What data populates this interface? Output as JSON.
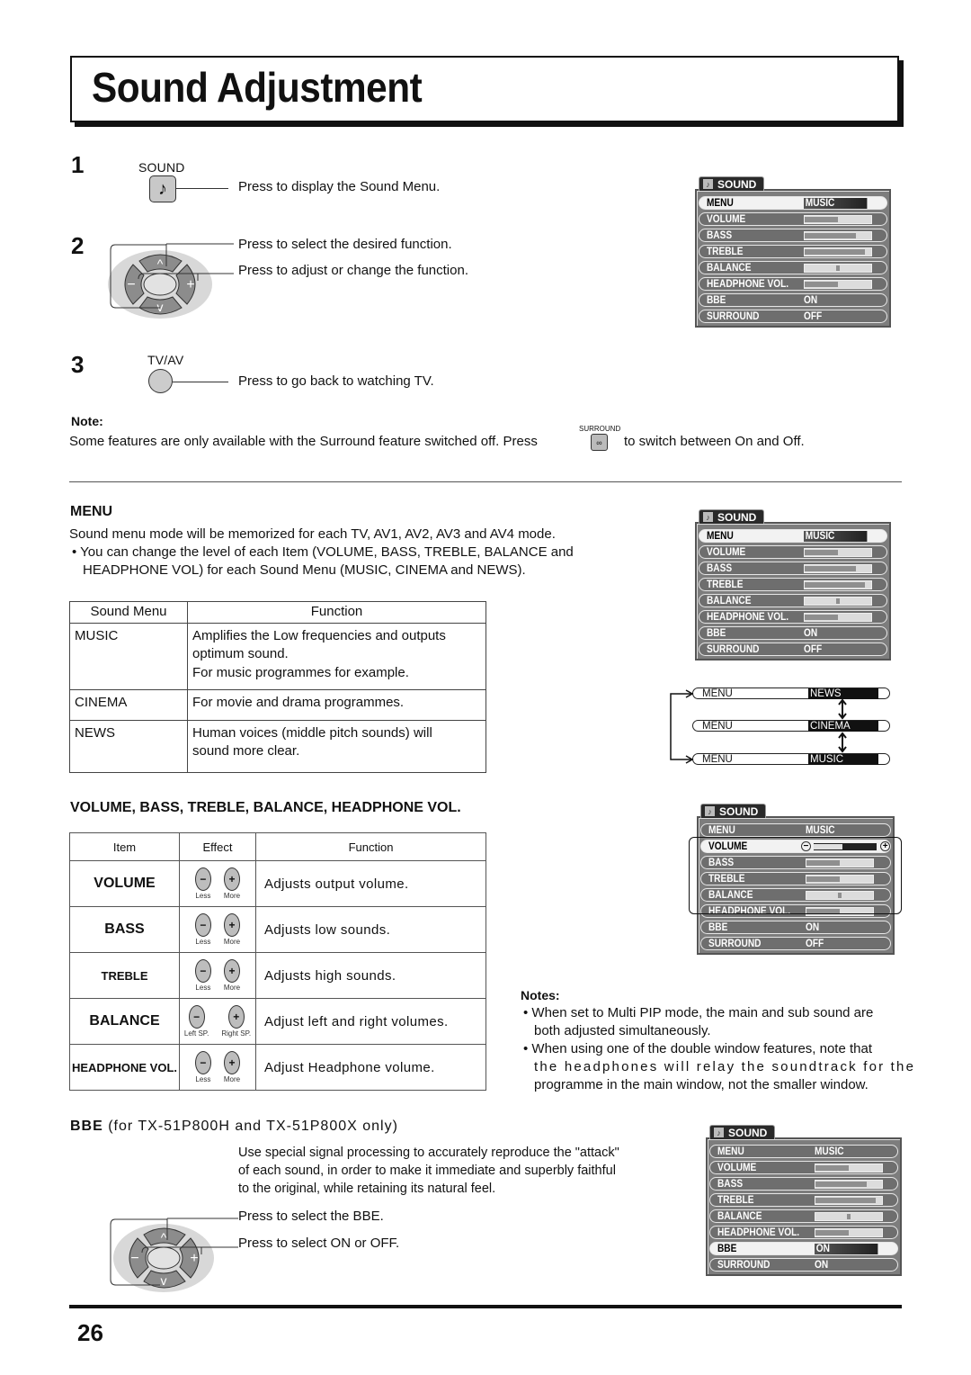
{
  "page": {
    "title": "Sound Adjustment",
    "page_number": "26"
  },
  "steps": [
    {
      "number": "1",
      "key_label": "SOUND",
      "key_icon": "music-note-icon",
      "instructions": [
        "Press to display the Sound Menu."
      ]
    },
    {
      "number": "2",
      "key_label": "",
      "key_icon": "direction-pad-icon",
      "instructions": [
        "Press to select the desired function.",
        "Press to adjust or change the function."
      ]
    },
    {
      "number": "3",
      "key_label": "TV/AV",
      "key_icon": "round-button-icon",
      "instructions": [
        "Press to go back to watching TV."
      ]
    }
  ],
  "dpad": {
    "up": "^",
    "down": "v",
    "left": "−",
    "right": "+"
  },
  "note": {
    "heading": "Note:",
    "text_before": "Some features are only available with the Surround feature switched off. Press",
    "button_label": "SURROUND",
    "text_after": "to switch between On and Off."
  },
  "osd_main": {
    "tab": "SOUND",
    "rows": [
      {
        "label": "MENU",
        "type": "value",
        "value": "MUSIC",
        "selected": true
      },
      {
        "label": "VOLUME",
        "type": "bar",
        "level": 0.5
      },
      {
        "label": "BASS",
        "type": "bar",
        "level": 0.77
      },
      {
        "label": "TREBLE",
        "type": "bar",
        "level": 0.9
      },
      {
        "label": "BALANCE",
        "type": "balance",
        "level": 0.5
      },
      {
        "label": "HEADPHONE  VOL.",
        "type": "bar",
        "level": 0.5
      },
      {
        "label": "BBE",
        "type": "value",
        "value": "ON"
      },
      {
        "label": "SURROUND",
        "type": "value",
        "value": "OFF"
      }
    ]
  },
  "menu_section": {
    "heading": "MENU",
    "line1": "Sound menu mode will be memorized for each TV, AV1, AV2, AV3 and AV4 mode.",
    "bullet": "• You can change the level of each Item (VOLUME, BASS, TREBLE, BALANCE and",
    "bullet_cont": "HEADPHONE VOL) for each Sound Menu (MUSIC, CINEMA and NEWS).",
    "table": {
      "headers": [
        "Sound Menu",
        "Function"
      ],
      "rows": [
        {
          "menu": "MUSIC",
          "function": [
            "Amplifies the Low frequencies and outputs",
            "optimum sound.",
            "For music programmes for example."
          ]
        },
        {
          "menu": "CINEMA",
          "function": [
            "For movie and drama programmes."
          ]
        },
        {
          "menu": "NEWS",
          "function": [
            "Human voices (middle pitch sounds) will",
            "sound more clear."
          ]
        }
      ]
    },
    "cycle": [
      {
        "label": "MENU",
        "value": "NEWS"
      },
      {
        "label": "MENU",
        "value": "CINEMA"
      },
      {
        "label": "MENU",
        "value": "MUSIC"
      }
    ]
  },
  "osd_menu": {
    "tab": "SOUND",
    "rows": [
      {
        "label": "MENU",
        "type": "value",
        "value": "MUSIC",
        "selected": true
      },
      {
        "label": "VOLUME",
        "type": "bar",
        "level": 0.5
      },
      {
        "label": "BASS",
        "type": "bar",
        "level": 0.77
      },
      {
        "label": "TREBLE",
        "type": "bar",
        "level": 0.9
      },
      {
        "label": "BALANCE",
        "type": "balance",
        "level": 0.5
      },
      {
        "label": "HEADPHONE  VOL.",
        "type": "bar",
        "level": 0.5
      },
      {
        "label": "BBE",
        "type": "value",
        "value": "ON"
      },
      {
        "label": "SURROUND",
        "type": "value",
        "value": "OFF"
      }
    ]
  },
  "levels_section": {
    "heading": "VOLUME, BASS, TREBLE, BALANCE, HEADPHONE VOL.",
    "table": {
      "headers": [
        "Item",
        "Effect",
        "Function"
      ],
      "rows": [
        {
          "item": "VOLUME",
          "less": "Less",
          "more": "More",
          "function": "Adjusts output volume."
        },
        {
          "item": "BASS",
          "less": "Less",
          "more": "More",
          "function": "Adjusts low sounds."
        },
        {
          "item": "TREBLE",
          "less": "Less",
          "more": "More",
          "function": "Adjusts high sounds."
        },
        {
          "item": "BALANCE",
          "less": "Left SP.",
          "more": "Right SP.",
          "function": "Adjust left and right volumes."
        },
        {
          "item": "HEADPHONE VOL.",
          "less": "Less",
          "more": "More",
          "function": "Adjust Headphone volume."
        }
      ]
    },
    "minus_symbol": "−",
    "plus_symbol": "+"
  },
  "osd_levels": {
    "tab": "SOUND",
    "rows": [
      {
        "label": "MENU",
        "type": "value",
        "value": "MUSIC"
      },
      {
        "label": "VOLUME",
        "type": "slider",
        "level": 0.45,
        "selected": true
      },
      {
        "label": "BASS",
        "type": "bar",
        "level": 0.5
      },
      {
        "label": "TREBLE",
        "type": "bar",
        "level": 0.5
      },
      {
        "label": "BALANCE",
        "type": "balance",
        "level": 0.5
      },
      {
        "label": "HEADPHONE  VOL.",
        "type": "bar",
        "level": 0.5
      },
      {
        "label": "BBE",
        "type": "value",
        "value": "ON"
      },
      {
        "label": "SURROUND",
        "type": "value",
        "value": "OFF"
      }
    ]
  },
  "notes": {
    "heading": "Notes:",
    "items": [
      [
        "• When set to Multi PIP mode, the main and sub sound are",
        "both adjusted simultaneously."
      ],
      [
        "• When using one of the double window features, note that",
        "the headphones will relay the soundtrack for the",
        "programme in the main window, not the smaller window."
      ]
    ]
  },
  "bbe_section": {
    "heading_bold": "BBE",
    "heading_rest": " (for TX-51P800H and TX-51P800X only)",
    "description": [
      "Use special signal processing to accurately reproduce the \"attack\"",
      "of each sound, in order to make it immediate and superbly faithful",
      "to the original, while retaining its natural feel."
    ],
    "instructions": [
      "Press to select the BBE.",
      "Press to select ON or OFF."
    ]
  },
  "osd_bbe": {
    "tab": "SOUND",
    "rows": [
      {
        "label": "MENU",
        "type": "value",
        "value": "MUSIC"
      },
      {
        "label": "VOLUME",
        "type": "bar",
        "level": 0.5
      },
      {
        "label": "BASS",
        "type": "bar",
        "level": 0.77
      },
      {
        "label": "TREBLE",
        "type": "bar",
        "level": 0.9
      },
      {
        "label": "BALANCE",
        "type": "balance",
        "level": 0.5
      },
      {
        "label": "HEADPHONE  VOL.",
        "type": "bar",
        "level": 0.5
      },
      {
        "label": "BBE",
        "type": "value",
        "value": "ON",
        "selected": true
      },
      {
        "label": "SURROUND",
        "type": "value",
        "value": "ON"
      }
    ]
  }
}
